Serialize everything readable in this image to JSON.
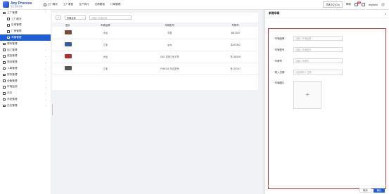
{
  "app": {
    "logo_main": "Any Process",
    "logo_sub": "化工智能仓库"
  },
  "topnav": [
    "工厂概况",
    "工厂看板",
    "生产执行",
    "仓储看板",
    "订单管理"
  ],
  "top_right": {
    "lang": "简体中文(CN)",
    "help": "帮助",
    "badge": "99",
    "user": "anyfarm"
  },
  "sidebar": [
    {
      "label": "工厂管理",
      "chev": "⌃"
    },
    {
      "label": "工厂概况",
      "chev": "",
      "sub": true
    },
    {
      "label": "区域管理",
      "chev": "",
      "sub": true
    },
    {
      "label": "厂房管理",
      "chev": "",
      "sub": true
    },
    {
      "label": "车辆管理",
      "chev": "",
      "sub": true,
      "active": true
    },
    {
      "label": "原料管理",
      "chev": "⌄"
    },
    {
      "label": "加工管理",
      "chev": "⌄"
    },
    {
      "label": "成品管理",
      "chev": "⌄"
    },
    {
      "label": "物流管理",
      "chev": "⌄"
    },
    {
      "label": "人事管理",
      "chev": "⌄"
    },
    {
      "label": "财务管理",
      "chev": "⌄"
    },
    {
      "label": "设备管理",
      "chev": "⌄"
    },
    {
      "label": "环境监测",
      "chev": "⌄"
    },
    {
      "label": "日志",
      "chev": "⌄"
    },
    {
      "label": "系统管理",
      "chev": "⌄"
    },
    {
      "label": "日志管理",
      "chev": "⌄"
    }
  ],
  "toolbar": {
    "select": "车辆名称",
    "search_placeholder": "请输入车辆名称"
  },
  "table": {
    "headers": [
      "图片",
      "车辆品牌",
      "车辆型号",
      "车牌号"
    ],
    "rows": [
      {
        "brand": "大运",
        "model": "华菱",
        "plate": "闽E2382",
        "color": "#7a4a3a"
      },
      {
        "brand": "江淮",
        "model": "gms",
        "plate": "粤A92382",
        "color": "#3a5a9a"
      },
      {
        "brand": "大运",
        "model": "180L 农用三轮卡车",
        "plate": "鲁C68348",
        "color": "#b03030"
      },
      {
        "brand": "江淮",
        "model": "PHM DS 马达型号",
        "plate": "鲁C97047",
        "color": "#555555"
      }
    ]
  },
  "drawer": {
    "title": "新增车辆",
    "close": "×",
    "fields": [
      {
        "label": "车辆品牌",
        "placeholder": "请输入车辆品牌"
      },
      {
        "label": "车辆型号",
        "placeholder": "请输入车辆型号"
      },
      {
        "label": "车牌号",
        "placeholder": "请输入车牌号"
      },
      {
        "label": "购入日期",
        "placeholder": "请选择购入日期"
      }
    ],
    "image_label": "车辆图片",
    "upload_plus": "+",
    "cancel": "取消",
    "confirm": "确认"
  }
}
